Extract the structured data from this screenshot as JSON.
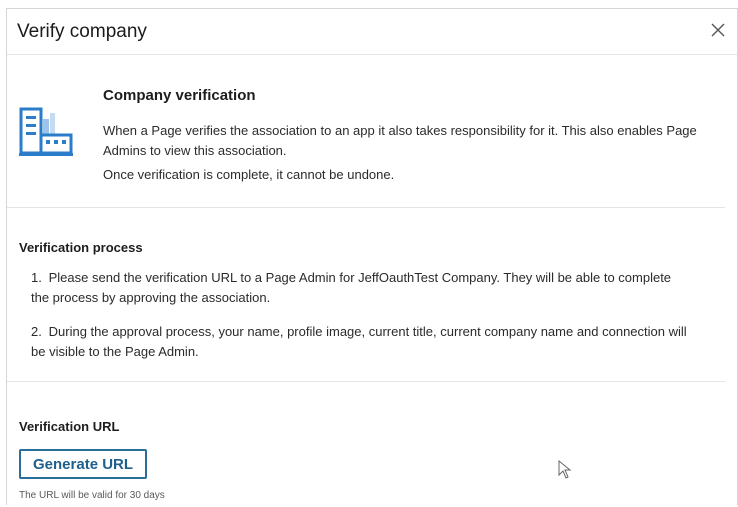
{
  "dialog": {
    "title": "Verify company"
  },
  "intro": {
    "heading": "Company verification",
    "paragraph1": "When a Page verifies the association to an app it also takes responsibility for it. This also enables Page Admins to view this association.",
    "paragraph2": "Once verification is complete, it cannot be undone."
  },
  "process": {
    "heading": "Verification process",
    "steps": [
      {
        "num": "1.",
        "text": "Please send the verification URL to a Page Admin for JeffOauthTest Company. They will be able to complete the process by approving the association."
      },
      {
        "num": "2.",
        "text": "During the approval process, your name, profile image, current title, current company name and connection will be visible to the Page Admin."
      }
    ]
  },
  "url_section": {
    "heading": "Verification URL",
    "button_label": "Generate URL",
    "hint": "The URL will be valid for 30 days"
  },
  "colors": {
    "accent": "#1f5f8b",
    "icon_blue": "#2b7cc9"
  },
  "icons": [
    "building-icon",
    "close-icon",
    "mouse-cursor-icon"
  ]
}
